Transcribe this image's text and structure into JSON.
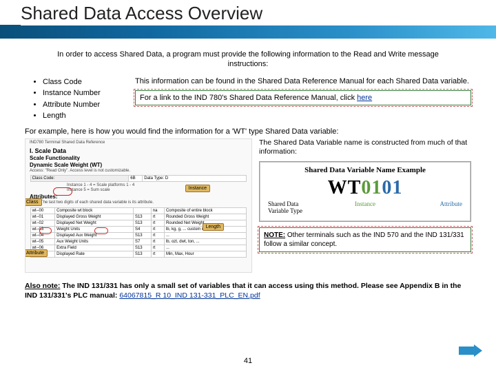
{
  "title": "Shared Data Access Overview",
  "intro": "In order to access Shared Data, a program must provide the following information to the Read and Write message instructions:",
  "bullets": [
    "Class Code",
    "Instance Number",
    "Attribute Number",
    "Length"
  ],
  "info_text": "This information can be found in the Shared Data Reference Manual for each Shared Data variable.",
  "link_box_prefix": "For a link to the IND 780's Shared Data Reference Manual, click ",
  "link_box_link": "here",
  "example_line": "For example, here is how you would find the information for a 'WT' type Shared Data variable:",
  "doc_snippet": {
    "top_line": "IND780 Terminal Shared Data Reference",
    "section": "I. Scale Data",
    "sub1": "Scale Functionality",
    "sub2": "Dynamic Scale Weight (WT)",
    "access_line": "Access: \"Read Only\". Access level is not customizable.",
    "class_label": "Class Code:",
    "class_val": "6B",
    "data_type_label": "Data Type: D",
    "instances_text": "Instance 1 - 4 = Scale platforms 1 - 4\nInstance 5 = Sum scale",
    "attributes_label": "Attributes:",
    "note_line": "Note: The last two digits of each shared data variable is its attribute.",
    "rows": [
      {
        "c1": "wt--00",
        "c2": "Composite wt block",
        "c3": "",
        "c4": "na",
        "c5": "Composite of entire block"
      },
      {
        "c1": "wt--01",
        "c2": "Displayed Gross Weight",
        "c3": "S13",
        "c4": "rt",
        "c5": "Rounded Gross Weight"
      },
      {
        "c1": "wt--02",
        "c2": "Displayed Net Weight",
        "c3": "S13",
        "c4": "rt",
        "c5": "Rounded Net Weight"
      },
      {
        "c1": "wt--03",
        "c2": "Weight Units",
        "c3": "S4",
        "c4": "rt",
        "c5": "lb, kg, g, ... custom units"
      },
      {
        "c1": "wt--04",
        "c2": "Displayed Aux Weight",
        "c3": "S13",
        "c4": "rt",
        "c5": "..."
      },
      {
        "c1": "wt--05",
        "c2": "Aux Weight Units",
        "c3": "S7",
        "c4": "rt",
        "c5": "lb, ozt, dwt, ton, ..."
      },
      {
        "c1": "wt--06",
        "c2": "Extra Field",
        "c3": "S13",
        "c4": "rt",
        "c5": "..."
      },
      {
        "c1": "wt--07",
        "c2": "Displayed Rate",
        "c3": "S13",
        "c4": "rt",
        "c5": "Min, Max, Hour"
      }
    ]
  },
  "callouts": {
    "class": "Class",
    "instance": "Instance",
    "length": "Length",
    "attribute": "Attribute"
  },
  "var_intro": "The Shared Data Variable name is constructed from much of that information:",
  "var_box_title": "Shared Data Variable Name Example",
  "wt_example": {
    "prefix": "WT",
    "mid": "01",
    "suffix": "01"
  },
  "var_annos": {
    "a1": "Shared Data\nVariable Type",
    "a2": "Instance",
    "a3": "Attribute"
  },
  "note_box_label": "NOTE:",
  "note_box_text": "  Other terminals such as the IND 570 and the IND 131/331 follow a similar concept.",
  "also_label": "Also note:",
  "also_text1": "  The IND 131/331 has only a small set of variables that it can access using this method. Please see Appendix B in the IND 131/331's PLC manual: ",
  "also_link": "64067815_R 10_IND 131-331_PLC_EN.pdf",
  "page_number": "41"
}
